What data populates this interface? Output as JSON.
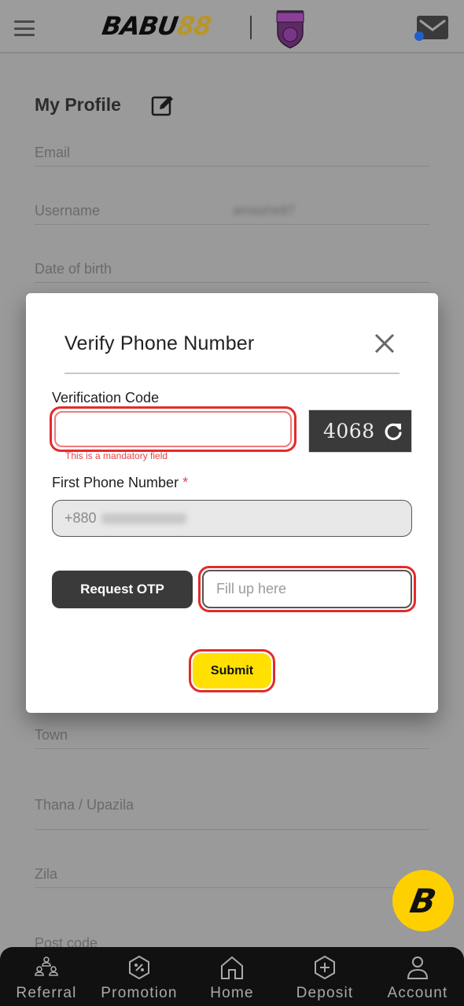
{
  "header": {
    "brand_part1": "BABU",
    "brand_part2": "88",
    "team_badge": "strikers-badge"
  },
  "profile": {
    "title": "My Profile",
    "fields": [
      {
        "label": "Email",
        "value": ""
      },
      {
        "label": "Username",
        "value": "amashe87"
      },
      {
        "label": "Date of birth",
        "value": ""
      },
      {
        "label": "Town",
        "value": ""
      },
      {
        "label": "Thana / Upazila",
        "value": ""
      },
      {
        "label": "Zila",
        "value": ""
      },
      {
        "label": "Post code",
        "value": ""
      }
    ]
  },
  "modal": {
    "title": "Verify Phone Number",
    "verification_label": "Verification Code",
    "verification_value": "",
    "error_text": "This is a mandatory field",
    "captcha_code": "4068",
    "phone_label": "First Phone Number",
    "phone_required_mark": "*",
    "phone_prefix": "+880",
    "request_otp_label": "Request OTP",
    "otp_placeholder": "Fill up here",
    "submit_label": "Submit"
  },
  "fab": {
    "label": "B"
  },
  "bottom_nav": {
    "items": [
      {
        "label": "Referral",
        "icon": "referral-icon"
      },
      {
        "label": "Promotion",
        "icon": "promotion-icon"
      },
      {
        "label": "Home",
        "icon": "home-icon"
      },
      {
        "label": "Deposit",
        "icon": "deposit-icon"
      },
      {
        "label": "Account",
        "icon": "account-icon"
      }
    ]
  },
  "colors": {
    "accent_yellow": "#ffe000",
    "error_red": "#e32b2b",
    "dark": "#3a3a3a",
    "overlay_bg": "#9a9a9a"
  }
}
